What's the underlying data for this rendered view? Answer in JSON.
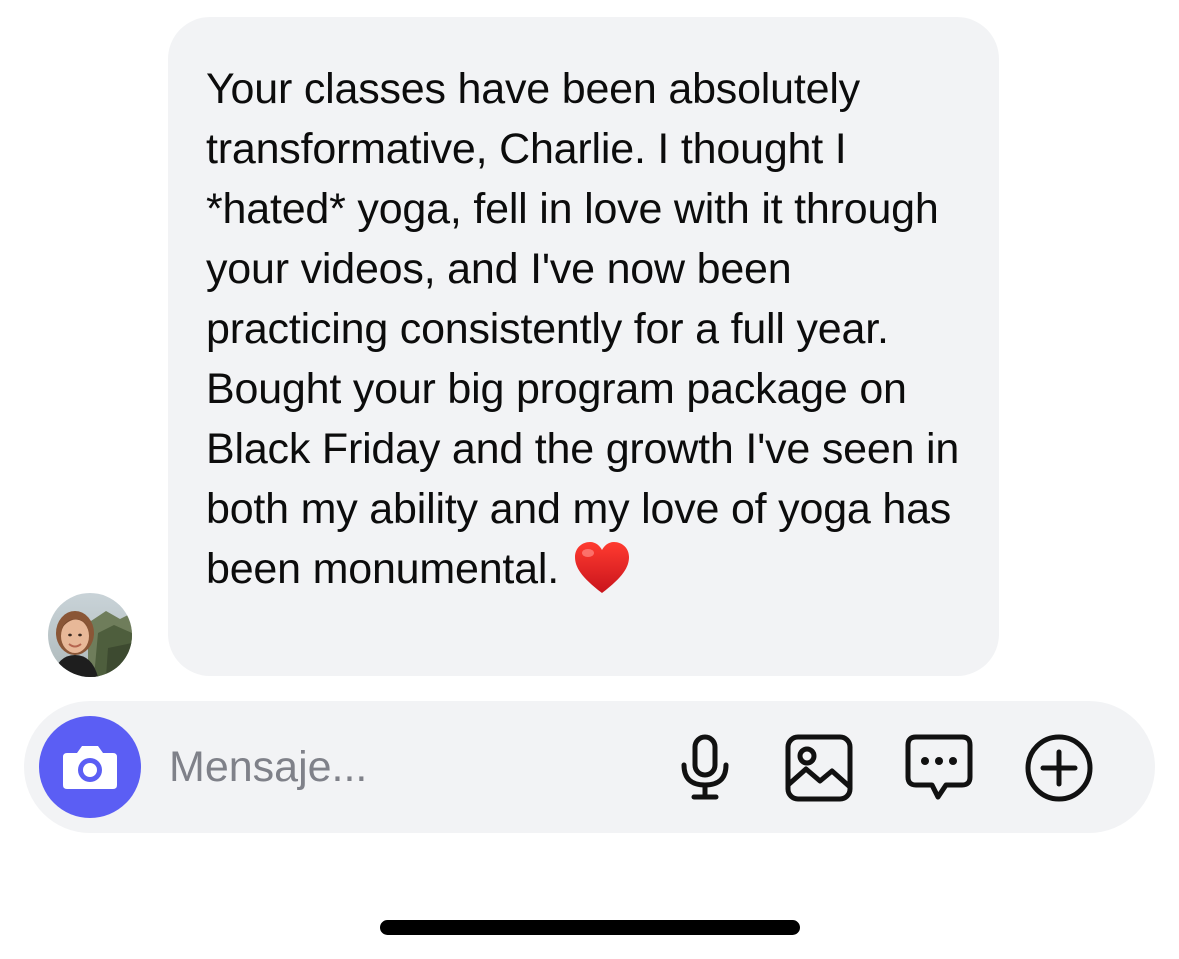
{
  "conversation": {
    "contact_avatar": "contact-avatar",
    "message": {
      "text": "Your classes have been absolutely transformative, Charlie. I thought I *hated* yoga, fell in love with it through your videos, and I've now been practicing consistently for a full year. Bought your big program package on Black Friday and the growth I've seen in both my ability and my love of yoga has been monumental.",
      "emoji": "heart-icon",
      "bubble_color": "#f2f3f5"
    }
  },
  "composer": {
    "placeholder": "Mensaje...",
    "value": "",
    "camera_icon": "camera-icon",
    "camera_color": "#5b5ef4",
    "actions": [
      {
        "name": "microphone-icon"
      },
      {
        "name": "image-icon"
      },
      {
        "name": "sticker-chat-icon"
      },
      {
        "name": "plus-circle-icon"
      }
    ]
  },
  "system": {
    "home_indicator": "home-indicator"
  }
}
